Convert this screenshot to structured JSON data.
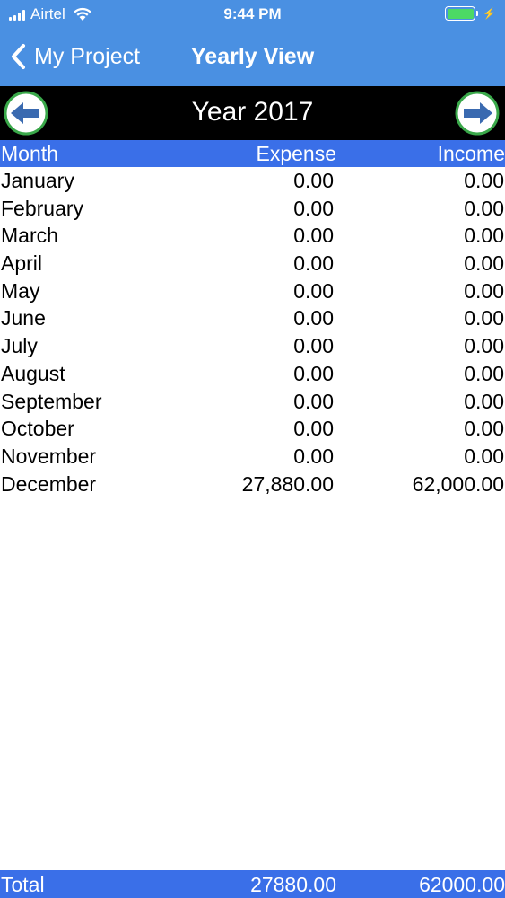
{
  "status_bar": {
    "carrier": "Airtel",
    "time": "9:44 PM",
    "battery_color": "#4cd964"
  },
  "nav": {
    "back_label": "My Project",
    "title": "Yearly View",
    "back_icon": "chevron-left-icon"
  },
  "year_bar": {
    "title": "Year 2017",
    "prev_icon": "arrow-left-circle-icon",
    "next_icon": "arrow-right-circle-icon"
  },
  "table": {
    "columns": [
      "Month",
      "Expense",
      "Income"
    ],
    "rows": [
      {
        "month": "January",
        "expense": "0.00",
        "income": "0.00"
      },
      {
        "month": "February",
        "expense": "0.00",
        "income": "0.00"
      },
      {
        "month": "March",
        "expense": "0.00",
        "income": "0.00"
      },
      {
        "month": "April",
        "expense": "0.00",
        "income": "0.00"
      },
      {
        "month": "May",
        "expense": "0.00",
        "income": "0.00"
      },
      {
        "month": "June",
        "expense": "0.00",
        "income": "0.00"
      },
      {
        "month": "July",
        "expense": "0.00",
        "income": "0.00"
      },
      {
        "month": "August",
        "expense": "0.00",
        "income": "0.00"
      },
      {
        "month": "September",
        "expense": "0.00",
        "income": "0.00"
      },
      {
        "month": "October",
        "expense": "0.00",
        "income": "0.00"
      },
      {
        "month": "November",
        "expense": "0.00",
        "income": "0.00"
      },
      {
        "month": "December",
        "expense": "27,880.00",
        "income": "62,000.00"
      }
    ]
  },
  "footer": {
    "label": "Total",
    "expense_total": "27880.00",
    "income_total": "62000.00"
  },
  "colors": {
    "header_blue": "#4a90e2",
    "table_header_blue": "#3a6fe8",
    "year_bar": "#000000",
    "arrow_fill": "#3a6ab0",
    "arrow_ring": "#3aa84a"
  }
}
